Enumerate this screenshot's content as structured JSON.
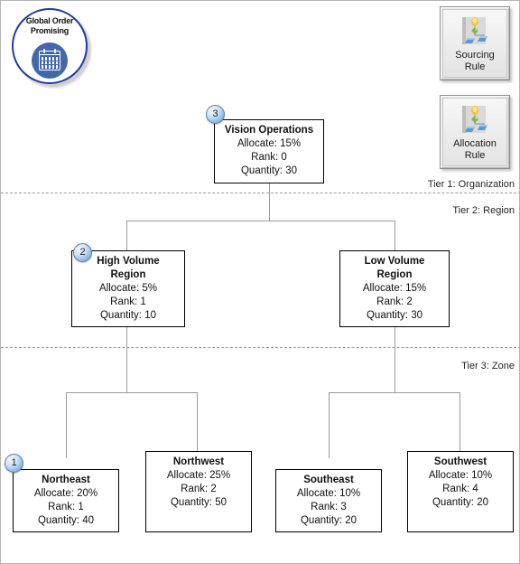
{
  "app": {
    "badge_title_line1": "Global Order",
    "badge_title_line2": "Promising",
    "badge_icon": "calendar-icon"
  },
  "buttons": [
    {
      "label_line1": "Sourcing",
      "label_line2": "Rule",
      "icon": "sourcing-rule-tree-icon"
    },
    {
      "label_line1": "Allocation",
      "label_line2": "Rule",
      "icon": "allocation-rule-tree-icon"
    }
  ],
  "tiers": [
    {
      "label": "Tier 1: Organization"
    },
    {
      "label": "Tier 2: Region"
    },
    {
      "label": "Tier 3: Zone"
    }
  ],
  "nodes": {
    "vision_operations": {
      "name": "Vision Operations",
      "allocate": "Allocate: 15%",
      "rank": "Rank: 0",
      "quantity": "Quantity: 30",
      "callout": "3"
    },
    "high_volume_region": {
      "name_line1": "High Volume",
      "name_line2": "Region",
      "allocate": "Allocate: 5%",
      "rank": "Rank: 1",
      "quantity": "Quantity: 10",
      "callout": "2"
    },
    "low_volume_region": {
      "name_line1": "Low Volume",
      "name_line2": "Region",
      "allocate": "Allocate: 15%",
      "rank": "Rank: 2",
      "quantity": "Quantity: 30"
    },
    "northeast": {
      "name": "Northeast",
      "allocate": "Allocate: 20%",
      "rank": "Rank: 1",
      "quantity": "Quantity: 40",
      "callout": "1"
    },
    "northwest": {
      "name": "Northwest",
      "allocate": "Allocate: 25%",
      "rank": "Rank: 2",
      "quantity": "Quantity: 50"
    },
    "southeast": {
      "name": "Southeast",
      "allocate": "Allocate: 10%",
      "rank": "Rank: 3",
      "quantity": "Quantity: 20"
    },
    "southwest": {
      "name": "Southwest",
      "allocate": "Allocate: 10%",
      "rank": "Rank: 4",
      "quantity": "Quantity: 20"
    }
  },
  "colors": {
    "brand_blue": "#1f3d9e",
    "icon_blue": "#4367ab",
    "connector_gray": "#9b9b9b",
    "node_border": "#000000",
    "tier_dash": "#9a9a9a"
  }
}
